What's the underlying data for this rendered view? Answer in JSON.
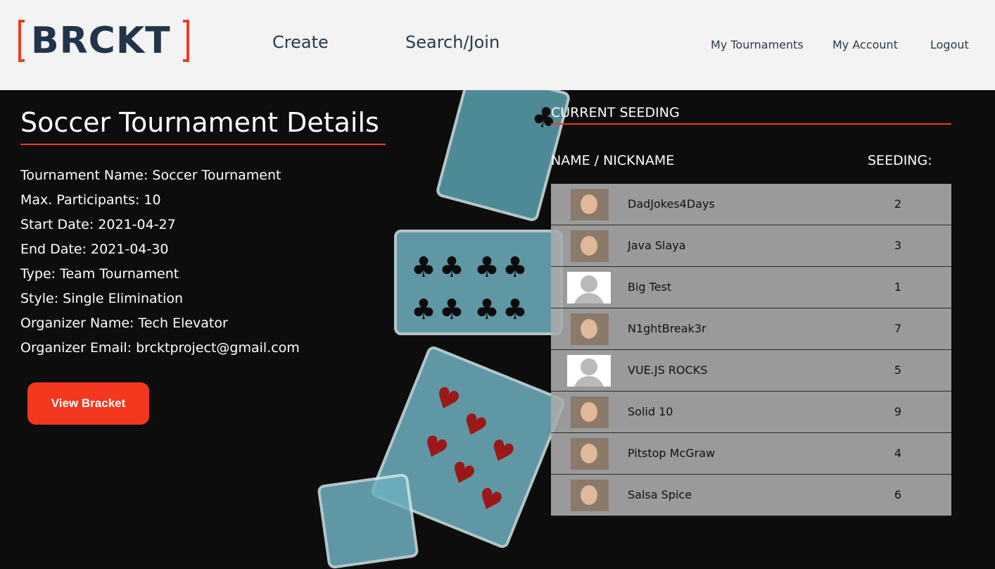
{
  "header": {
    "logo_text": "BRCKT",
    "nav_main": [
      "Create",
      "Search/Join"
    ],
    "nav_right": [
      "My Tournaments",
      "My Account",
      "Logout"
    ]
  },
  "details": {
    "title": "Soccer Tournament Details",
    "lines": [
      "Tournament Name: Soccer Tournament",
      "Max. Participants: 10",
      "Start Date: 2021-04-27",
      "End Date: 2021-04-30",
      "Type: Team Tournament",
      "Style: Single Elimination",
      "Organizer Name: Tech Elevator",
      "Organizer Email: brcktproject@gmail.com"
    ],
    "view_bracket_label": "View Bracket"
  },
  "seeding": {
    "title": "CURRENT SEEDING",
    "col_name": "NAME / NICKNAME",
    "col_seed": "SEEDING:",
    "rows": [
      {
        "name": "DadJokes4Days",
        "seed": "2",
        "avatar": "photo"
      },
      {
        "name": "Java Slaya",
        "seed": "3",
        "avatar": "photo"
      },
      {
        "name": "Big Test",
        "seed": "1",
        "avatar": "default"
      },
      {
        "name": "N1ghtBreak3r",
        "seed": "7",
        "avatar": "photo"
      },
      {
        "name": "VUE.JS ROCKS",
        "seed": "5",
        "avatar": "default"
      },
      {
        "name": "Solid 10",
        "seed": "9",
        "avatar": "photo"
      },
      {
        "name": "Pitstop McGraw",
        "seed": "4",
        "avatar": "photo"
      },
      {
        "name": "Salsa Spice",
        "seed": "6",
        "avatar": "photo"
      }
    ]
  },
  "colors": {
    "accent": "#ef3b24",
    "button": "#f3381f",
    "logo": "#22344a",
    "header_bg": "#f3f3f3",
    "page_bg": "#0d0d0d"
  }
}
